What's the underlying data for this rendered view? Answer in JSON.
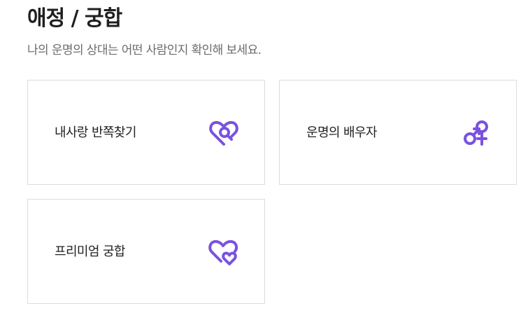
{
  "header": {
    "title": "애정 / 궁합",
    "subtitle": "나의 운명의 상대는 어떤 사람인지 확인해 보세요."
  },
  "cards": [
    {
      "label": "내사랑 반쪽찾기",
      "icon": "heart-search-icon"
    },
    {
      "label": "운명의 배우자",
      "icon": "gender-symbols-icon"
    },
    {
      "label": "프리미엄 궁합",
      "icon": "double-heart-icon"
    }
  ],
  "colors": {
    "accent": "#7a52e0",
    "title": "#1f1f1f",
    "subtitle": "#6b6b6b",
    "border": "#dcdcdc"
  }
}
